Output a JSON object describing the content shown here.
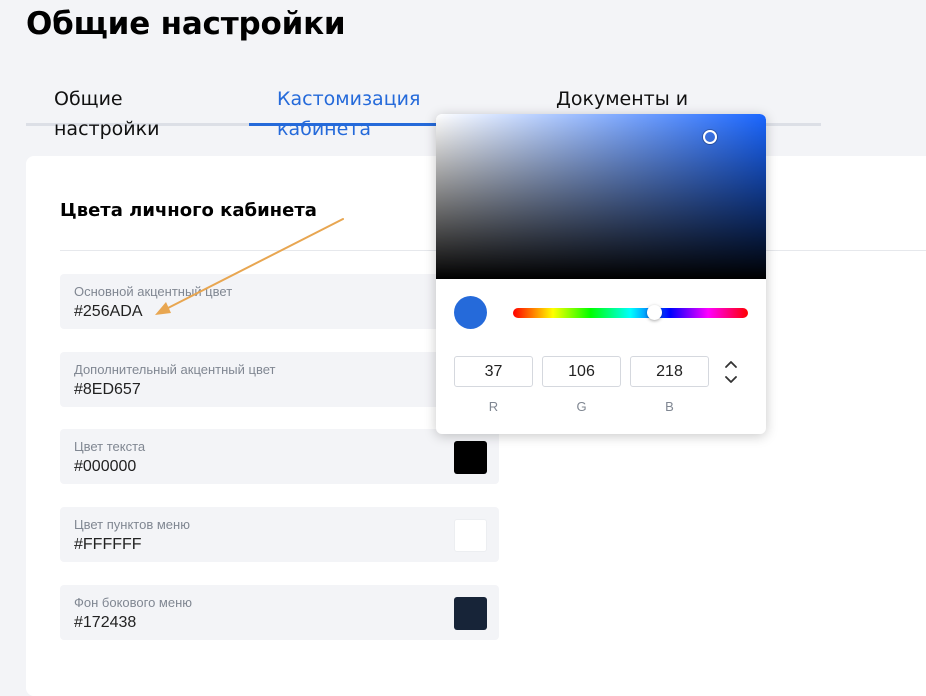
{
  "page": {
    "title": "Общие настройки"
  },
  "tabs": [
    {
      "label": "Общие настройки"
    },
    {
      "label": "Кастомизация кабинета"
    },
    {
      "label": "Документы и соглашения"
    }
  ],
  "colors": {
    "accent": "#256ada",
    "page_bg": "#f3f4f7",
    "annotation_arrow": "#e8a651"
  },
  "section": {
    "title": "Цвета личного кабинета"
  },
  "fields": [
    {
      "label": "Основной акцентный цвет",
      "value": "#256ADA",
      "swatch": "#256ADA"
    },
    {
      "label": "Дополнительный акцентный цвет",
      "value": "#8ED657",
      "swatch": "#8ED657"
    },
    {
      "label": "Цвет текста",
      "value": "#000000",
      "swatch": "#000000"
    },
    {
      "label": "Цвет пунктов меню",
      "value": "#FFFFFF",
      "swatch": "#FFFFFF"
    },
    {
      "label": "Фон бокового меню",
      "value": "#172438",
      "swatch": "#172438"
    }
  ],
  "picker": {
    "preview_color": "#256ADA",
    "r": "37",
    "g": "106",
    "b": "218",
    "r_label": "R",
    "g_label": "G",
    "b_label": "B",
    "hue_position": 0.6,
    "stepper_icon": "up-down-chevron-icon"
  }
}
